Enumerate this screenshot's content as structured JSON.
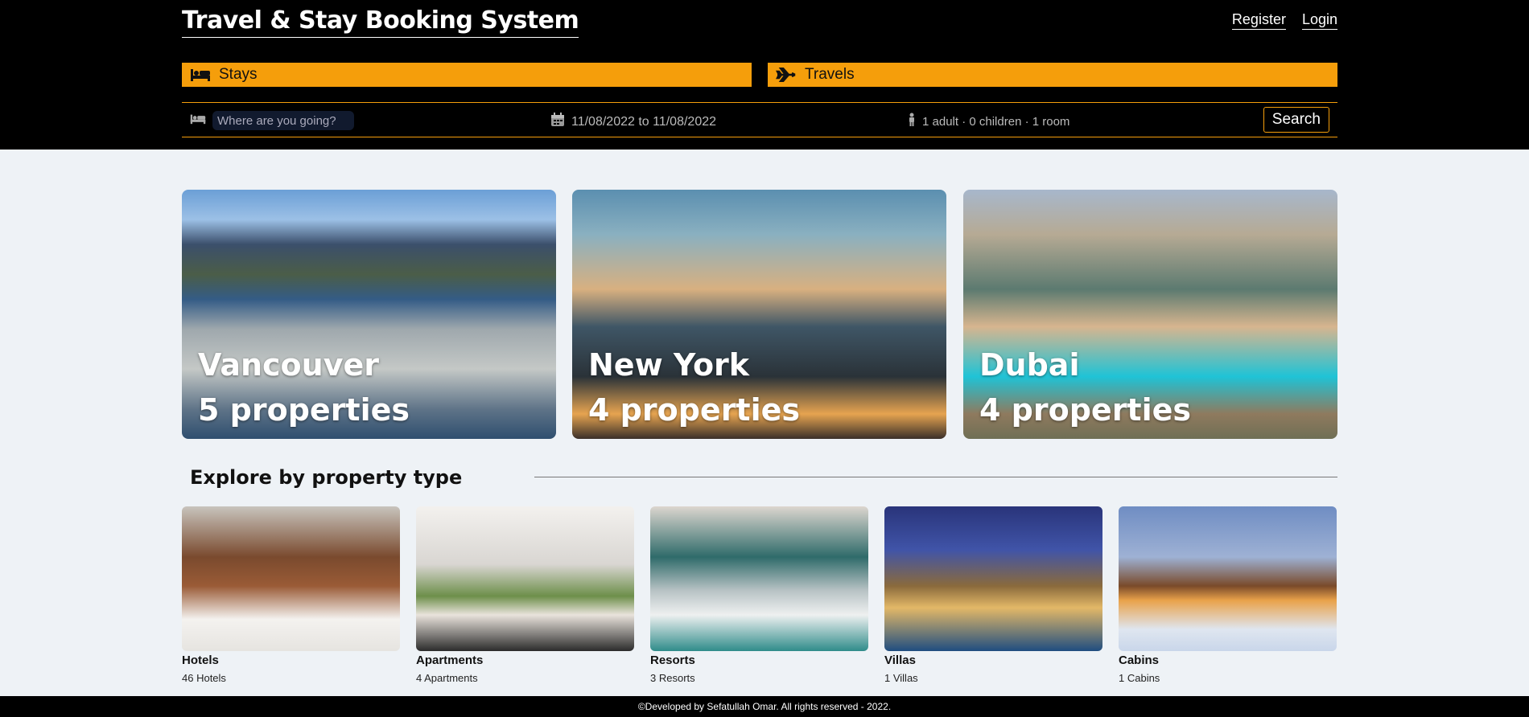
{
  "header": {
    "brand": "Travel & Stay Booking System",
    "register": "Register",
    "login": "Login"
  },
  "modes": [
    {
      "label": "Stays",
      "icon": "bed-icon"
    },
    {
      "label": "Travels",
      "icon": "plane-icon"
    }
  ],
  "search": {
    "destination_placeholder": "Where are you going?",
    "dates": "11/08/2022 to 11/08/2022",
    "occupancy": "1 adult · 0 children · 1 room",
    "button": "Search"
  },
  "featured": [
    {
      "city": "Vancouver",
      "properties": "5 properties"
    },
    {
      "city": "New York",
      "properties": "4 properties"
    },
    {
      "city": "Dubai",
      "properties": "4 properties"
    }
  ],
  "property_section": {
    "title": "Explore by property type",
    "types": [
      {
        "name": "Hotels",
        "count": "46 Hotels"
      },
      {
        "name": "Apartments",
        "count": "4 Apartments"
      },
      {
        "name": "Resorts",
        "count": "3 Resorts"
      },
      {
        "name": "Villas",
        "count": "1 Villas"
      },
      {
        "name": "Cabins",
        "count": "1 Cabins"
      }
    ]
  },
  "footer": {
    "text": "©Developed by Sefatullah Omar. All rights reserved - 2022."
  },
  "colors": {
    "accent": "#f59e0b",
    "header_bg": "#000000",
    "page_bg": "#eef2f6"
  }
}
